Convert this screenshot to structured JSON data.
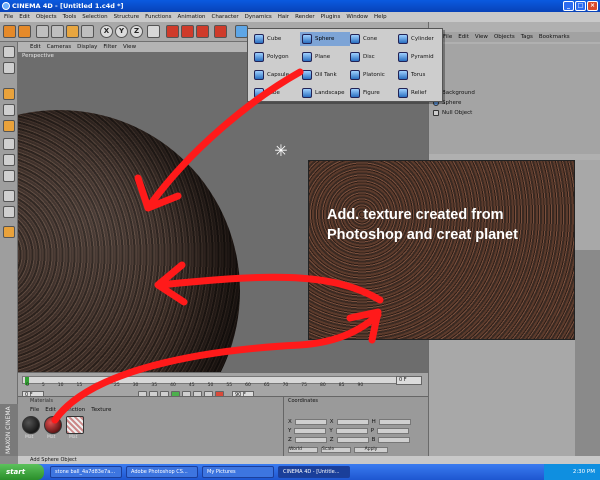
{
  "window": {
    "title": "CINEMA 4D - [Untitled 1.c4d *]"
  },
  "menubar": [
    "File",
    "Edit",
    "Objects",
    "Tools",
    "Selection",
    "Structure",
    "Functions",
    "Animation",
    "Character",
    "Dynamics",
    "Hair",
    "Render",
    "Plugins",
    "Window",
    "Help"
  ],
  "viewport": {
    "menu": [
      "Edit",
      "Cameras",
      "Display",
      "Filter",
      "View"
    ],
    "label": "Perspective"
  },
  "primitives": [
    {
      "label": "Cube",
      "icon": "cube-icon"
    },
    {
      "label": "Sphere",
      "icon": "sphere-icon"
    },
    {
      "label": "Cone",
      "icon": "cone-icon"
    },
    {
      "label": "Cylinder",
      "icon": "cylinder-icon"
    },
    {
      "label": "Polygon",
      "icon": "polygon-icon"
    },
    {
      "label": "Plane",
      "icon": "plane-icon"
    },
    {
      "label": "Disc",
      "icon": "disc-icon"
    },
    {
      "label": "Pyramid",
      "icon": "pyramid-icon"
    },
    {
      "label": "Capsule",
      "icon": "capsule-icon"
    },
    {
      "label": "Oil Tank",
      "icon": "oiltank-icon"
    },
    {
      "label": "Platonic",
      "icon": "platonic-icon"
    },
    {
      "label": "Torus",
      "icon": "torus-icon"
    },
    {
      "label": "Tube",
      "icon": "tube-icon"
    },
    {
      "label": "Landscape",
      "icon": "landscape-icon"
    },
    {
      "label": "Figure",
      "icon": "figure-icon"
    },
    {
      "label": "Relief",
      "icon": "relief-icon"
    }
  ],
  "object_manager": {
    "menu": [
      "File",
      "Edit",
      "View",
      "Objects",
      "Tags",
      "Bookmarks"
    ],
    "items": [
      "Background",
      "Sphere",
      "Null Object"
    ]
  },
  "materials": {
    "title": "Materials",
    "menu": [
      "File",
      "Edit",
      "Function",
      "Texture"
    ],
    "items": [
      "Mat",
      "Mat",
      "Mat"
    ]
  },
  "coordinates": {
    "title": "Coordinates",
    "rows": [
      "X",
      "Y",
      "Z"
    ],
    "cols2": [
      "X",
      "Y",
      "Z"
    ],
    "cols3": [
      "H",
      "P",
      "B"
    ],
    "mode": "World",
    "scale": "Scale",
    "apply": "Apply"
  },
  "timeline": {
    "ticks": [
      "0",
      "5",
      "10",
      "15",
      "20",
      "25",
      "30",
      "35",
      "40",
      "45",
      "50",
      "55",
      "60",
      "65",
      "70",
      "75",
      "80",
      "85",
      "90"
    ],
    "start_field": "0 F",
    "end_field": "90 F",
    "current_field": "0 F"
  },
  "annotation": {
    "text": "Add. texture created from Photoshop and creat planet",
    "arrow_color": "#ff1a1a"
  },
  "status": "Add Sphere Object",
  "maxon": "MAXON CINEMA 4D",
  "taskbar": {
    "start": "start",
    "tasks": [
      "stone ball_4a7d83e7a...",
      "Adobe Photoshop CS...",
      "My Pictures",
      "CINEMA 4D - [Untitle..."
    ],
    "clock": "2:30 PM"
  }
}
